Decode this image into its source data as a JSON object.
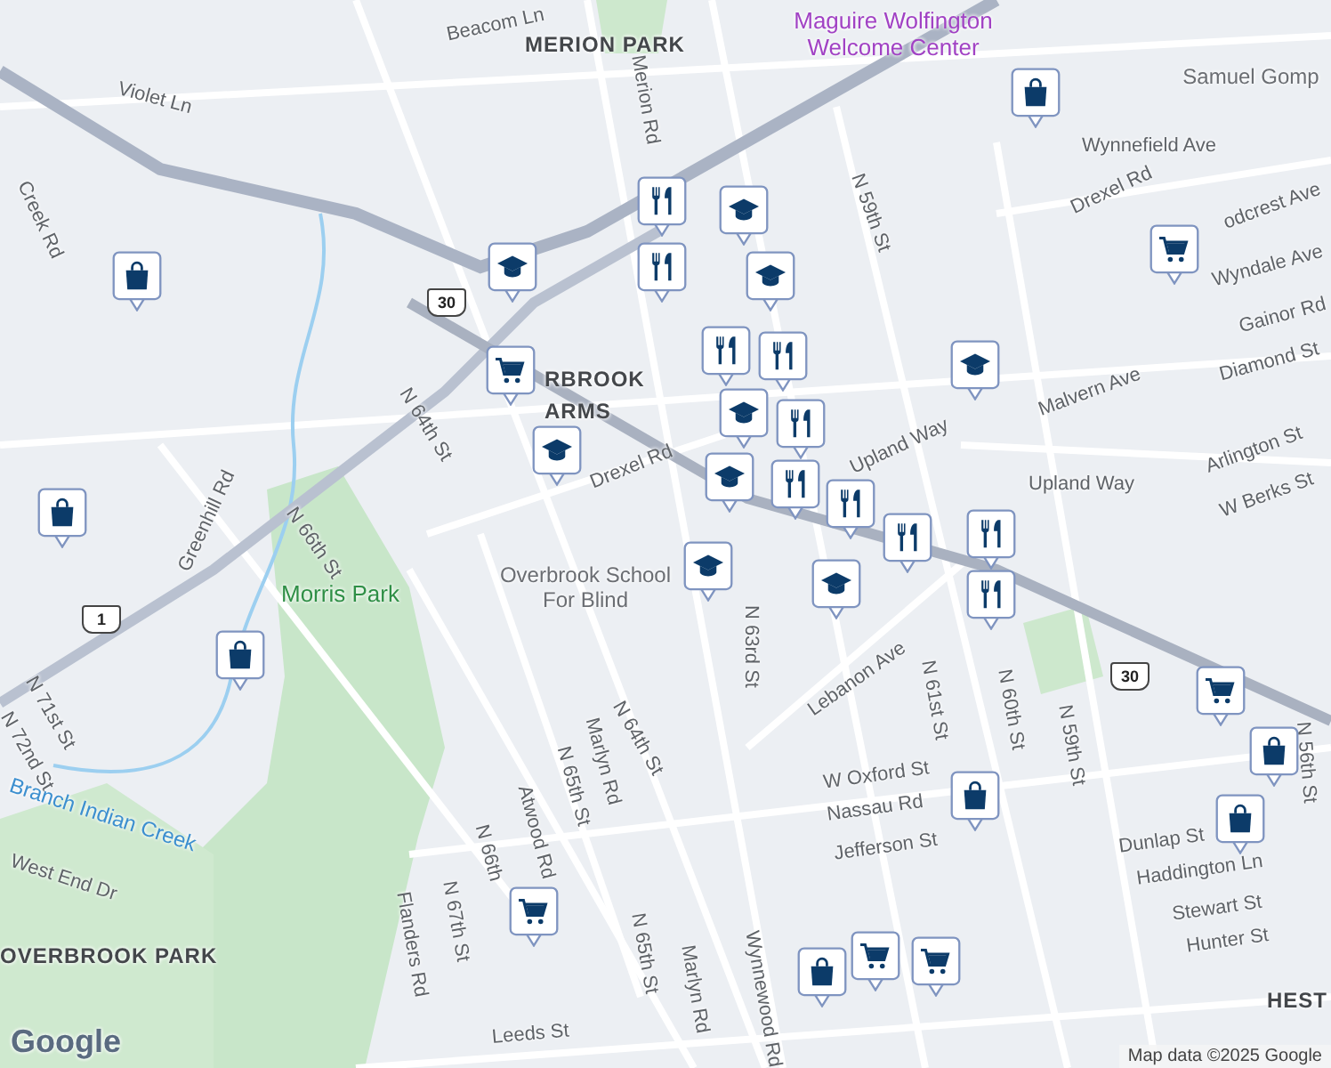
{
  "labels": [
    {
      "text": "Beacom Ln",
      "kind": "street"
    },
    {
      "text": "MERION PARK",
      "kind": "place"
    },
    {
      "text": "Maguire Wolfington Welcome Center",
      "kind": "poi"
    },
    {
      "text": "Samuel Gomp",
      "kind": "landmark"
    },
    {
      "text": "Violet Ln",
      "kind": "street"
    },
    {
      "text": "Merion Rd",
      "kind": "street"
    },
    {
      "text": "Wynnefield Ave",
      "kind": "street"
    },
    {
      "text": "N 59th St",
      "kind": "street"
    },
    {
      "text": "Drexel Rd",
      "kind": "street"
    },
    {
      "text": "odcrest Ave",
      "kind": "street"
    },
    {
      "text": "Wyndale Ave",
      "kind": "street"
    },
    {
      "text": "Gainor Rd",
      "kind": "street"
    },
    {
      "text": "Diamond St",
      "kind": "street"
    },
    {
      "text": "Malvern Ave",
      "kind": "street"
    },
    {
      "text": "Arlington St",
      "kind": "street"
    },
    {
      "text": "Upland Way",
      "kind": "street"
    },
    {
      "text": "Upland Way",
      "kind": "street"
    },
    {
      "text": "W Berks St",
      "kind": "street"
    },
    {
      "text": "RBROOK",
      "kind": "place"
    },
    {
      "text": "ARMS",
      "kind": "place"
    },
    {
      "text": "N 64th St",
      "kind": "street"
    },
    {
      "text": "Drexel Rd",
      "kind": "street"
    },
    {
      "text": "Morris Park",
      "kind": "park"
    },
    {
      "text": "N 66th St",
      "kind": "street"
    },
    {
      "text": "Overbrook School For Blind",
      "kind": "landmark"
    },
    {
      "text": "N 63rd St",
      "kind": "street"
    },
    {
      "text": "Lebanon Ave",
      "kind": "street"
    },
    {
      "text": "N 61st St",
      "kind": "street"
    },
    {
      "text": "N 60th St",
      "kind": "street"
    },
    {
      "text": "N 59th St",
      "kind": "street"
    },
    {
      "text": "W Oxford St",
      "kind": "street"
    },
    {
      "text": "Nassau Rd",
      "kind": "street"
    },
    {
      "text": "Jefferson St",
      "kind": "street"
    },
    {
      "text": "Dunlap St",
      "kind": "street"
    },
    {
      "text": "Haddington Ln",
      "kind": "street"
    },
    {
      "text": "Stewart St",
      "kind": "street"
    },
    {
      "text": "Hunter St",
      "kind": "street"
    },
    {
      "text": "N 64th St",
      "kind": "street"
    },
    {
      "text": "Marlyn Rd",
      "kind": "street"
    },
    {
      "text": "N 65th St",
      "kind": "street"
    },
    {
      "text": "Atwood Rd",
      "kind": "street"
    },
    {
      "text": "Wynnewood Rd",
      "kind": "street"
    },
    {
      "text": "N 65th St",
      "kind": "street"
    },
    {
      "text": "Marlyn Rd",
      "kind": "street"
    },
    {
      "text": "Flanders Rd",
      "kind": "street"
    },
    {
      "text": "N 67th St",
      "kind": "street"
    },
    {
      "text": "Greenhill Rd",
      "kind": "street"
    },
    {
      "text": "N 71st St",
      "kind": "street"
    },
    {
      "text": "N 72nd St",
      "kind": "street"
    },
    {
      "text": "Branch Indian Creek",
      "kind": "water"
    },
    {
      "text": "West End Dr",
      "kind": "street"
    },
    {
      "text": "OVERBROOK PARK",
      "kind": "place"
    },
    {
      "text": "Leeds St",
      "kind": "street"
    },
    {
      "text": "HEST",
      "kind": "place"
    },
    {
      "text": "Creek Rd",
      "kind": "street"
    },
    {
      "text": "N 56th St",
      "kind": "street"
    },
    {
      "text": "N 66th",
      "kind": "street"
    }
  ],
  "shields": [
    {
      "text": "30"
    },
    {
      "text": "1"
    },
    {
      "text": "30"
    }
  ],
  "markers": [
    {
      "kind": "school"
    },
    {
      "kind": "school"
    },
    {
      "kind": "school"
    },
    {
      "kind": "school"
    },
    {
      "kind": "school"
    },
    {
      "kind": "school"
    },
    {
      "kind": "school"
    },
    {
      "kind": "school"
    },
    {
      "kind": "school"
    },
    {
      "kind": "restaurant"
    },
    {
      "kind": "restaurant"
    },
    {
      "kind": "restaurant"
    },
    {
      "kind": "restaurant"
    },
    {
      "kind": "restaurant"
    },
    {
      "kind": "restaurant"
    },
    {
      "kind": "restaurant"
    },
    {
      "kind": "restaurant"
    },
    {
      "kind": "restaurant"
    },
    {
      "kind": "restaurant"
    },
    {
      "kind": "shopping"
    },
    {
      "kind": "shopping"
    },
    {
      "kind": "shopping"
    },
    {
      "kind": "shopping"
    },
    {
      "kind": "shopping"
    },
    {
      "kind": "shopping"
    },
    {
      "kind": "shopping"
    },
    {
      "kind": "shopping"
    },
    {
      "kind": "cart"
    },
    {
      "kind": "cart"
    },
    {
      "kind": "cart"
    },
    {
      "kind": "cart"
    },
    {
      "kind": "cart"
    },
    {
      "kind": "cart"
    }
  ],
  "logo": "Google",
  "attribution": "Map data ©2025 Google"
}
